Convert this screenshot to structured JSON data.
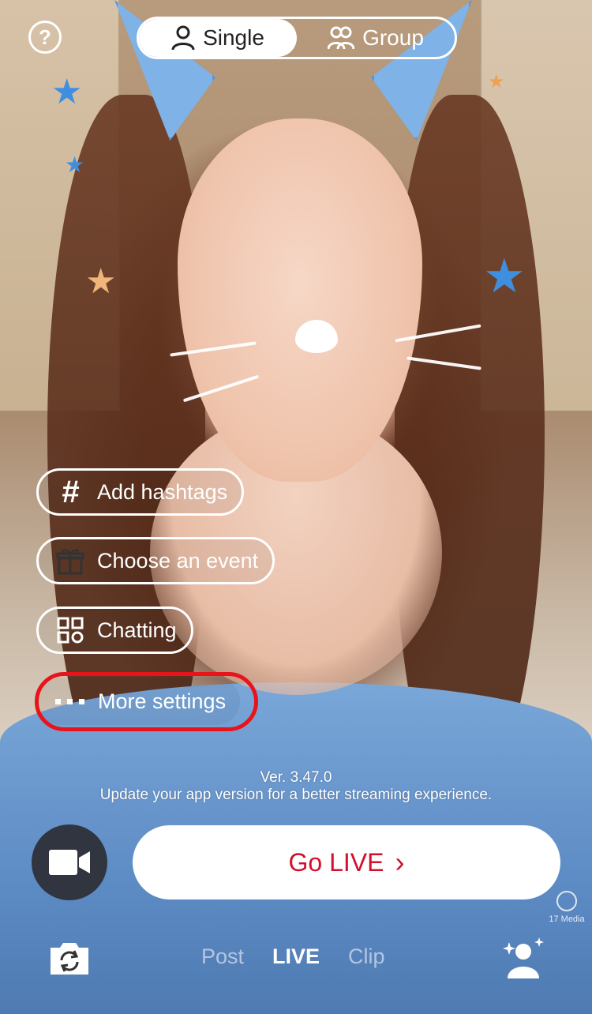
{
  "header": {
    "help_icon": "?",
    "mode": {
      "single_label": "Single",
      "group_label": "Group",
      "selected": "Single"
    }
  },
  "options": {
    "add_hashtags": "Add hashtags",
    "choose_event": "Choose an event",
    "chatting": "Chatting",
    "more_settings": "More settings"
  },
  "version": {
    "number": "Ver. 3.47.0",
    "message": "Update your app version for a better streaming experience."
  },
  "actions": {
    "go_live_label": "Go LIVE",
    "go_live_chevron": "›"
  },
  "watermark": {
    "text": "17 Media"
  },
  "bottom_tabs": {
    "post": "Post",
    "live": "LIVE",
    "clip": "Clip",
    "selected": "LIVE"
  },
  "colors": {
    "accent_red": "#d0112b",
    "highlight_red": "#e8141c",
    "camera_button_bg": "#303540"
  },
  "icons": {
    "help": "help-icon",
    "single_user": "person-icon",
    "group": "group-icon",
    "hashtag": "hashtag-icon",
    "event": "gift-icon",
    "chatting": "grid-icon",
    "more": "more-dots-icon",
    "camera": "video-camera-icon",
    "flip": "flip-camera-icon",
    "guest": "add-guest-icon"
  }
}
